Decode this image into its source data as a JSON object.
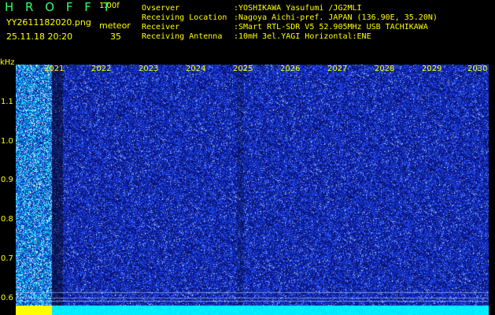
{
  "header": {
    "title": "H R O F F T",
    "version": "1.00f",
    "filename": "YY2611182020.png",
    "meteor_label": "meteor",
    "datetime": "25.11.18 20:20",
    "meteor_count": "35"
  },
  "info": [
    {
      "label": "Ovserver",
      "value": ":YOSHIKAWA Yasufumi /JG2MLI"
    },
    {
      "label": "Receiving Location",
      "value": ":Nagoya Aichi-pref. JAPAN (136.90E, 35.20N)"
    },
    {
      "label": "Receiver",
      "value": ":SMart RTL-SDR V5 52.905MHz USB TACHIKAWA"
    },
    {
      "label": "Receiving Antenna",
      "value": ":10mH 3el.YAGI Horizontal:ENE"
    }
  ],
  "axis": {
    "unit": "kHz",
    "y_ticks": [
      "1.1",
      "1.0",
      "0.9",
      "0.8",
      "0.7",
      "0.6"
    ],
    "x_ticks": [
      "2021",
      "2022",
      "2023",
      "2024",
      "2025",
      "2026",
      "2027",
      "2028",
      "2029",
      "2030"
    ]
  },
  "colors": {
    "background": "#000000",
    "label": "#ffff00",
    "title": "#33ff66",
    "spectrum_base": "#0a1a80",
    "spectrum_noise": "#2e5cff",
    "signal_high": "#00e5ff",
    "signal_peak": "#ffff00"
  }
}
